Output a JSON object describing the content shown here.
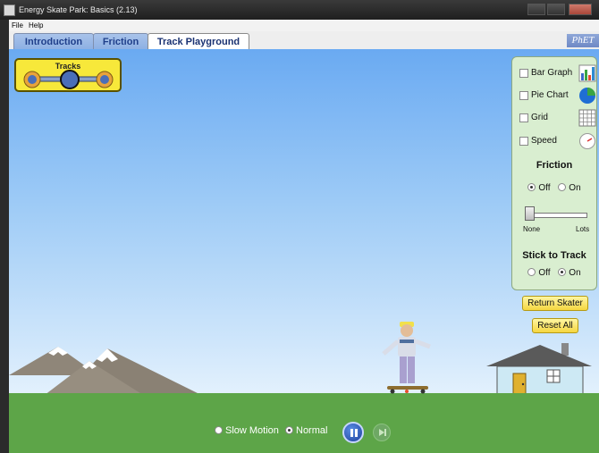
{
  "window": {
    "title": "Energy Skate Park: Basics (2.13)"
  },
  "menu": {
    "file": "File",
    "help": "Help"
  },
  "tabs": [
    {
      "label": "Introduction",
      "active": false
    },
    {
      "label": "Friction",
      "active": false
    },
    {
      "label": "Track Playground",
      "active": true
    }
  ],
  "logo": {
    "text": "PhET"
  },
  "tracks_panel": {
    "title": "Tracks"
  },
  "controls": {
    "bar_graph": {
      "label": "Bar Graph",
      "checked": false
    },
    "pie_chart": {
      "label": "Pie Chart",
      "checked": false
    },
    "grid": {
      "label": "Grid",
      "checked": false
    },
    "speed": {
      "label": "Speed",
      "checked": false
    },
    "friction": {
      "title": "Friction",
      "off": "Off",
      "on": "On",
      "selected": "Off",
      "slider_min": "None",
      "slider_max": "Lots",
      "level": 0
    },
    "stick_to_track": {
      "title": "Stick to Track",
      "off": "Off",
      "on": "On",
      "selected": "On"
    }
  },
  "buttons": {
    "return_skater": "Return Skater",
    "reset_all": "Reset All"
  },
  "playback": {
    "slow_motion": "Slow Motion",
    "normal": "Normal",
    "selected": "Normal"
  },
  "colors": {
    "sky": "#8fc3f5",
    "ground": "#5da548",
    "panel": "#d9eed0",
    "yellow": "#f7e83a"
  }
}
